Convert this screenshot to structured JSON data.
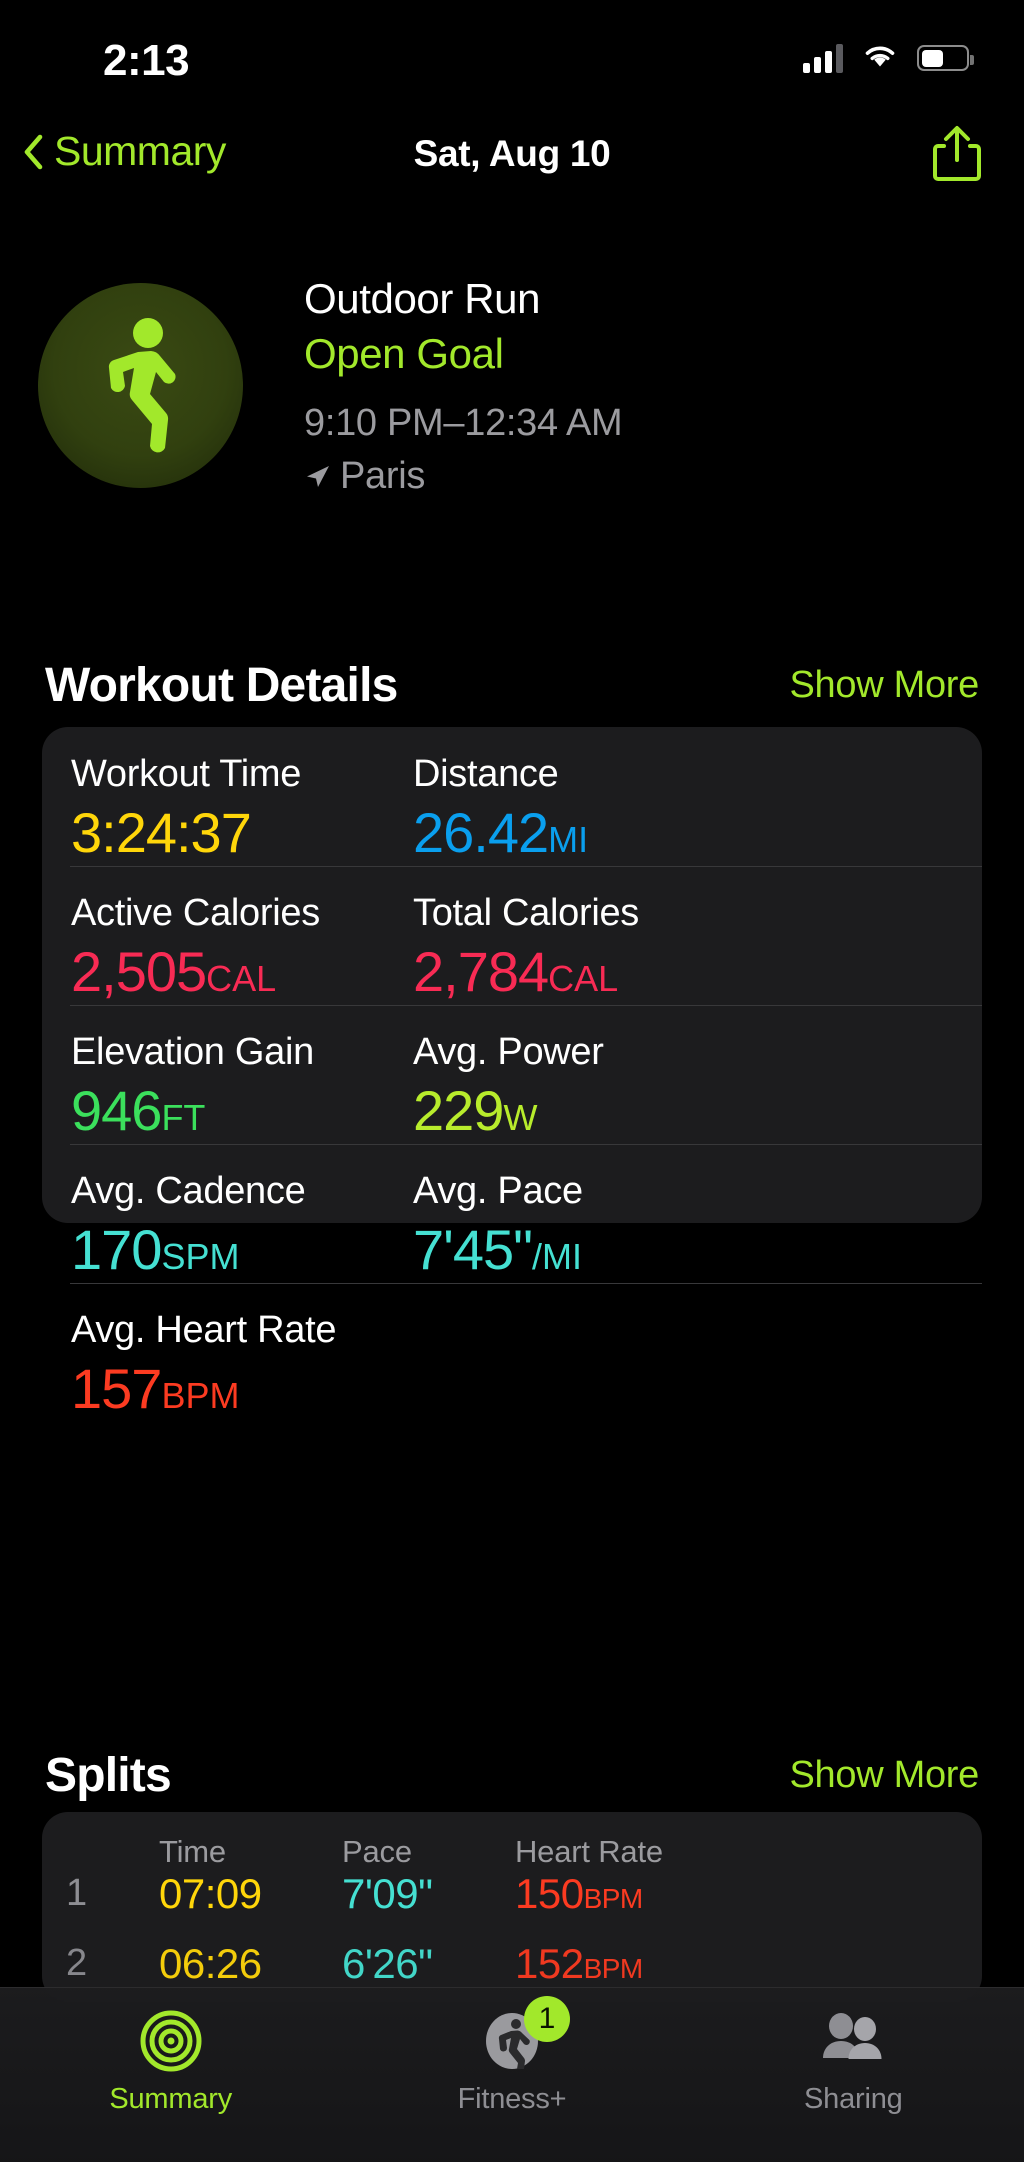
{
  "status_bar": {
    "time": "2:13",
    "cellular_icon": "cellular-signal-icon",
    "wifi_icon": "wifi-icon",
    "battery_icon": "battery-icon"
  },
  "nav": {
    "back_label": "Summary",
    "title": "Sat, Aug 10",
    "share_icon": "share-icon",
    "back_icon": "chevron-left-icon"
  },
  "workout": {
    "activity_icon": "running-person-icon",
    "type": "Outdoor Run",
    "goal": "Open Goal",
    "time_range": "9:10 PM–12:34 AM",
    "location": "Paris",
    "location_icon": "location-arrow-icon"
  },
  "details_section": {
    "title": "Workout Details",
    "show_more": "Show More",
    "rows": [
      [
        {
          "label": "Workout Time",
          "value": "3:24:37",
          "unit": "",
          "color": "#FFD60A"
        },
        {
          "label": "Distance",
          "value": "26.42",
          "unit": "MI",
          "color": "#0A9FEE"
        }
      ],
      [
        {
          "label": "Active Calories",
          "value": "2,505",
          "unit": "CAL",
          "color": "#F82B54"
        },
        {
          "label": "Total Calories",
          "value": "2,784",
          "unit": "CAL",
          "color": "#F82B54"
        }
      ],
      [
        {
          "label": "Elevation Gain",
          "value": "946",
          "unit": "FT",
          "color": "#3BE05C"
        },
        {
          "label": "Avg. Power",
          "value": "229",
          "unit": "W",
          "color": "#B8EC2C"
        }
      ],
      [
        {
          "label": "Avg. Cadence",
          "value": "170",
          "unit": "SPM",
          "color": "#45E0D2"
        },
        {
          "label": "Avg. Pace",
          "value": "7'45\"",
          "unit": "/MI",
          "color": "#45E0D2"
        }
      ],
      [
        {
          "label": "Avg. Heart Rate",
          "value": "157",
          "unit": "BPM",
          "color": "#FC3B21"
        }
      ]
    ]
  },
  "splits_section": {
    "title": "Splits",
    "show_more": "Show More",
    "columns": {
      "index": "",
      "time": "Time",
      "pace": "Pace",
      "heart_rate": "Heart Rate"
    },
    "rows": [
      {
        "index": "1",
        "time": "07:09",
        "pace": "7'09\"",
        "hr": "150",
        "hr_unit": "BPM"
      },
      {
        "index": "2",
        "time": "06:26",
        "pace": "6'26\"",
        "hr": "152",
        "hr_unit": "BPM"
      }
    ]
  },
  "tab_bar": {
    "items": [
      {
        "label": "Summary",
        "icon": "activity-rings-icon",
        "active": true,
        "badge": ""
      },
      {
        "label": "Fitness+",
        "icon": "fitness-plus-icon",
        "active": false,
        "badge": "1"
      },
      {
        "label": "Sharing",
        "icon": "people-icon",
        "active": false,
        "badge": ""
      }
    ]
  },
  "colors": {
    "accent_green": "#A2E82B",
    "card_bg": "#1C1C1E",
    "page_bg": "#000000",
    "divider": "#38383A",
    "secondary_text": "#9B9B9F"
  }
}
